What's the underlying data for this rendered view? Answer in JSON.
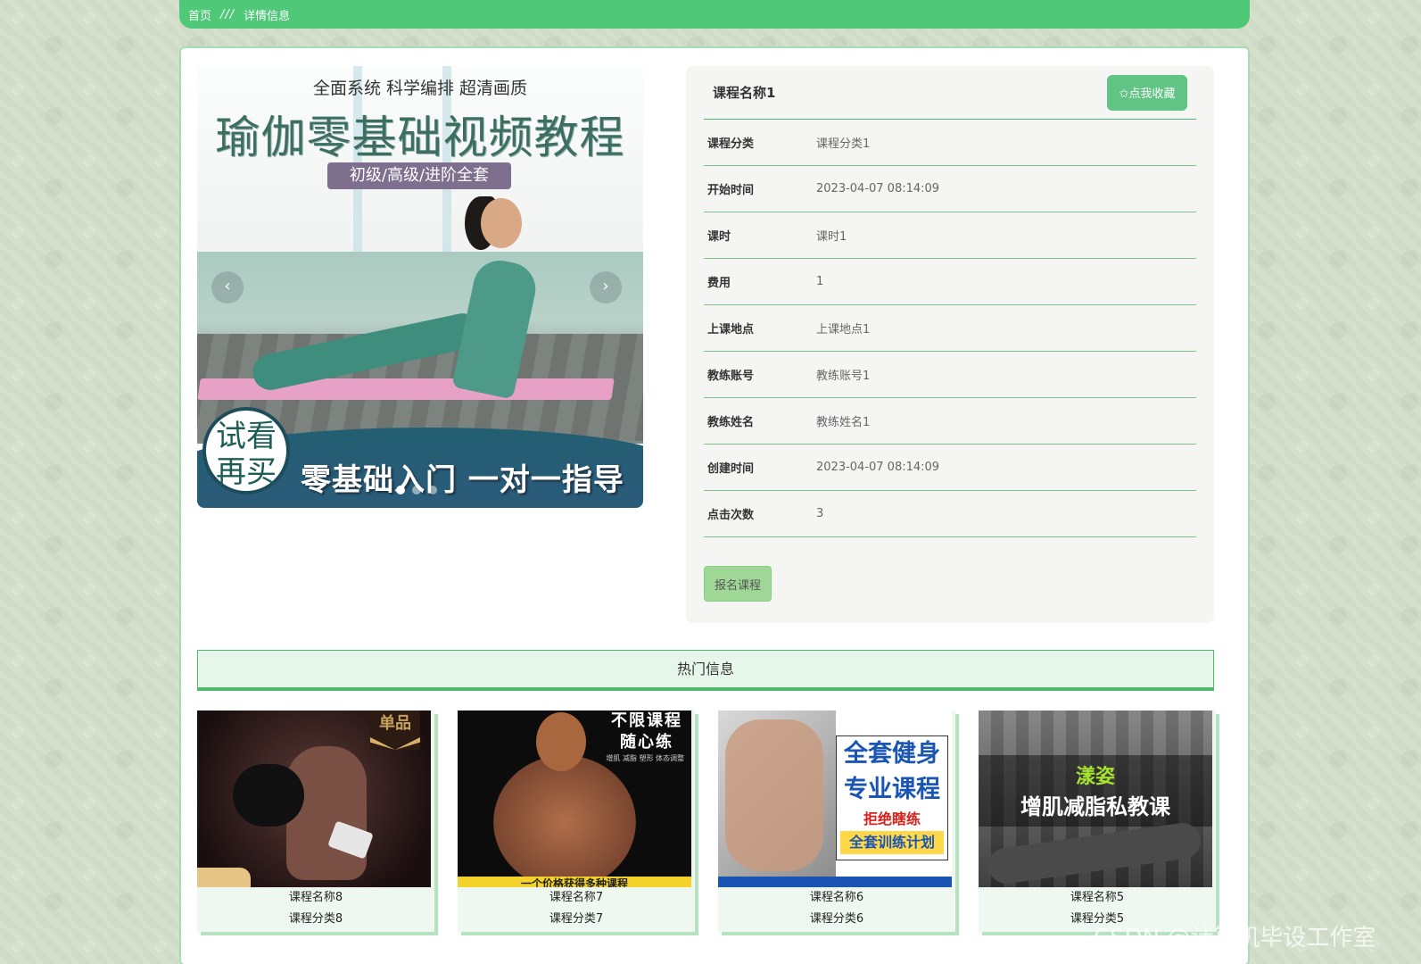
{
  "breadcrumb": {
    "home": "首页",
    "separator": "///",
    "current": "详情信息"
  },
  "banner": {
    "tagline": "全面系统  科学编排  超清画质",
    "title": "瑜伽零基础视频教程",
    "sub": "初级/高级/进阶全套",
    "circle_line1": "试看",
    "circle_line2": "再买",
    "slogan": "零基础入门 一对一指导",
    "prev_icon": "‹",
    "next_icon": "›",
    "slide_count": 3,
    "active_slide": 1
  },
  "info": {
    "course_name": "课程名称1",
    "favorite_label": "✩点我收藏",
    "rows": [
      {
        "label": "课程分类",
        "value": "课程分类1"
      },
      {
        "label": "开始时间",
        "value": "2023-04-07 08:14:09"
      },
      {
        "label": "课时",
        "value": "课时1"
      },
      {
        "label": "费用",
        "value": "1"
      },
      {
        "label": "上课地点",
        "value": "上课地点1"
      },
      {
        "label": "教练账号",
        "value": "教练账号1"
      },
      {
        "label": "教练姓名",
        "value": "教练姓名1"
      },
      {
        "label": "创建时间",
        "value": "2023-04-07 08:14:09"
      },
      {
        "label": "点击次数",
        "value": "3"
      }
    ],
    "signup_label": "报名课程"
  },
  "hot": {
    "title": "热门信息",
    "cards": [
      {
        "name": "课程名称8",
        "category": "课程分类8",
        "img_text": "单品"
      },
      {
        "name": "课程名称7",
        "category": "课程分类7",
        "img_text": "不限课程\n随心练",
        "img_small": "增肌 减脂 塑形 体态调整",
        "img_bar": "一个价格获得多种课程"
      },
      {
        "name": "课程名称6",
        "category": "课程分类6",
        "img_l1": "全套健身",
        "img_l2": "专业课程",
        "img_l3": "拒绝瞎练",
        "img_l4": "全套训练计划"
      },
      {
        "name": "课程名称5",
        "category": "课程分类5",
        "img_a": "漾姿",
        "img_b": "增肌减脂私教课"
      }
    ]
  },
  "watermark": "CSDN @计算机毕设工作室",
  "colors": {
    "accent": "#4fc878",
    "button": "#61c485",
    "signup": "#9fd896",
    "divider": "#7fc08a"
  }
}
